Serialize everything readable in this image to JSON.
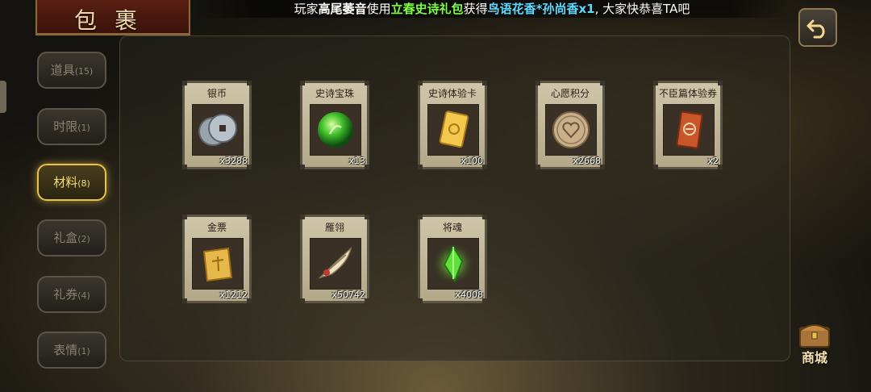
{
  "header": {
    "title": "包裹",
    "broadcast": {
      "prefix": "玩家",
      "player": "高尾萎音",
      "used": "使用",
      "gift": "立春史诗礼包",
      "obtained": "获得",
      "item": "鸟语花香*孙尚香x1",
      "suffix": ", 大家快恭喜TA吧"
    }
  },
  "tabs": [
    {
      "label": "道具",
      "count": "(15)",
      "active": false
    },
    {
      "label": "时限",
      "count": "(1)",
      "active": false
    },
    {
      "label": "材料",
      "count": "(8)",
      "active": true
    },
    {
      "label": "礼盒",
      "count": "(2)",
      "active": false
    },
    {
      "label": "礼券",
      "count": "(4)",
      "active": false
    },
    {
      "label": "表情",
      "count": "(1)",
      "active": false
    }
  ],
  "items": [
    {
      "name": "银币",
      "qty": "x3288",
      "icon": "silver-coin-icon"
    },
    {
      "name": "史诗宝珠",
      "qty": "x13",
      "icon": "green-orb-icon"
    },
    {
      "name": "史诗体验卡",
      "qty": "x100",
      "icon": "gold-card-icon"
    },
    {
      "name": "心愿积分",
      "qty": "x2668",
      "icon": "heart-coin-icon"
    },
    {
      "name": "不臣篇体验券",
      "qty": "x2",
      "icon": "ticket-icon"
    },
    {
      "name": "金票",
      "qty": "x1212",
      "icon": "gold-scroll-icon"
    },
    {
      "name": "雁翎",
      "qty": "x50742",
      "icon": "feather-icon"
    },
    {
      "name": "将魂",
      "qty": "x4008",
      "icon": "green-crystal-icon"
    }
  ],
  "shop": {
    "label": "商城"
  },
  "colors": {
    "active_tab": "#e8c24a",
    "gift_text": "#7dff45",
    "item_text": "#5cd8ff"
  }
}
